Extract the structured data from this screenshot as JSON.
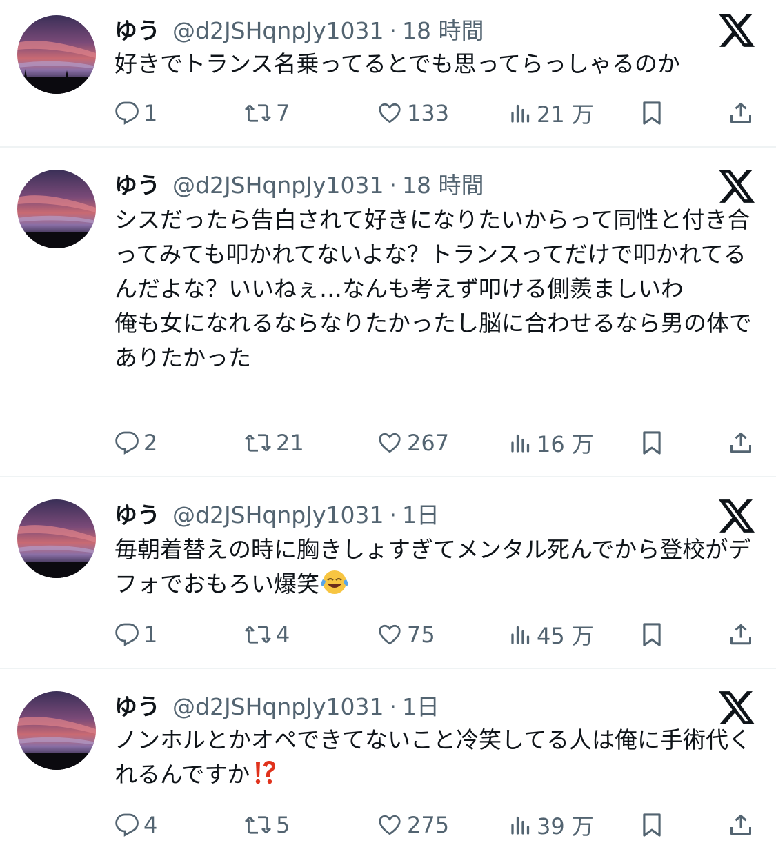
{
  "colors": {
    "text": "#0f1419",
    "secondary": "#536471",
    "divider": "#eff3f4",
    "exclaim": "#e0321c",
    "emoji_face": "#f7c542"
  },
  "tweets": [
    {
      "name": "ゆう",
      "handle": "@d2JSHqnpJy1031",
      "separator": "·",
      "time": "18 時間",
      "text": "好きでトランス名乗ってるとでも思ってらっしゃるのか",
      "emoji": "",
      "replies": "1",
      "retweets": "7",
      "likes": "133",
      "views": "21 万"
    },
    {
      "name": "ゆう",
      "handle": "@d2JSHqnpJy1031",
      "separator": "·",
      "time": "18 時間",
      "text": "シスだったら告白されて好きになりたいからって同性と付き合ってみても叩かれてないよな？トランスってだけで叩かれてるんだよな？いいねぇ…なんも考えず叩ける側羨ましいわ\n俺も女になれるならなりたかったし脳に合わせるなら男の体でありたかった",
      "emoji": "",
      "replies": "2",
      "retweets": "21",
      "likes": "267",
      "views": "16 万"
    },
    {
      "name": "ゆう",
      "handle": "@d2JSHqnpJy1031",
      "separator": "·",
      "time": "1日",
      "text": "毎朝着替えの時に胸きしょすぎてメンタル死んでから登校がデフォでおもろい爆笑",
      "emoji": "face-with-tears-of-joy",
      "replies": "1",
      "retweets": "4",
      "likes": "75",
      "views": "45 万"
    },
    {
      "name": "ゆう",
      "handle": "@d2JSHqnpJy1031",
      "separator": "·",
      "time": "1日",
      "text": "ノンホルとかオペできてないこと冷笑してる人は俺に手術代くれるんですか",
      "emoji": "exclamation-question-mark",
      "replies": "4",
      "retweets": "5",
      "likes": "275",
      "views": "39 万"
    }
  ]
}
